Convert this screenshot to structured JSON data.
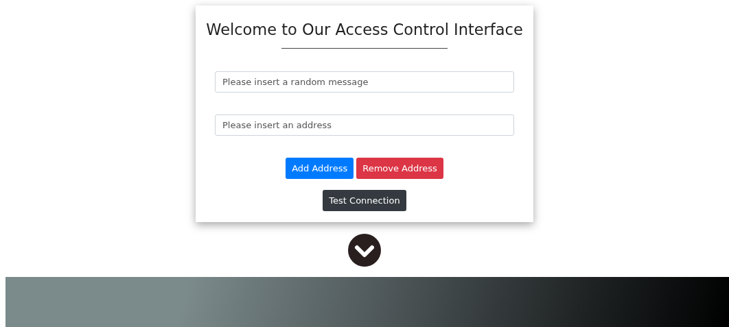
{
  "card": {
    "title": "Welcome to Our Access Control Interface",
    "fields": [
      {
        "placeholder": "Please insert a random message"
      },
      {
        "placeholder": "Please insert an address"
      }
    ],
    "button_rows": [
      [
        {
          "label": "Add Address",
          "kind": "primary"
        },
        {
          "label": "Remove Address",
          "kind": "danger"
        }
      ],
      [
        {
          "label": "Test Connection",
          "kind": "dark"
        }
      ]
    ]
  }
}
